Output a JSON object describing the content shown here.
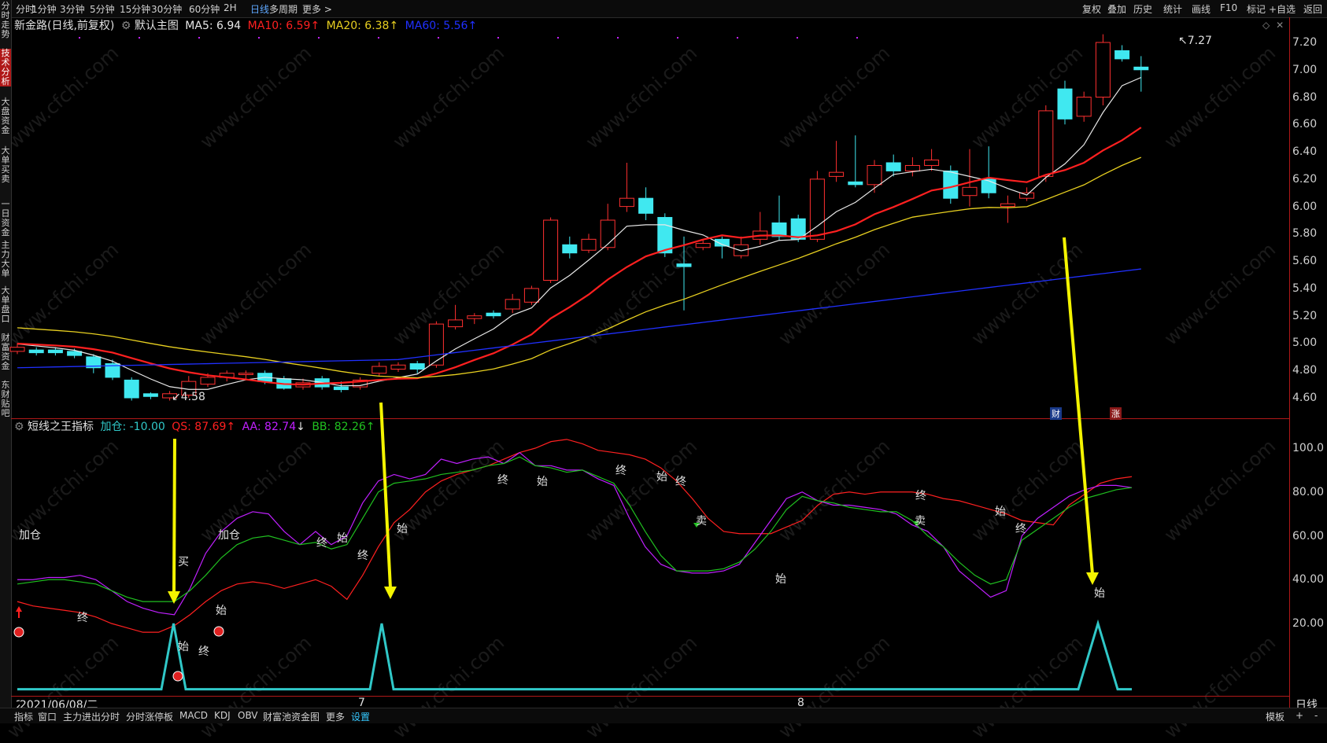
{
  "toolbar": {
    "left_items": [
      "分时",
      "1分钟",
      "3分钟",
      "5分钟",
      "15分钟",
      "30分钟",
      "60分钟",
      "2H",
      "日线",
      "多周期",
      "更多 >"
    ],
    "active_index": 8,
    "right_items": [
      "复权",
      "叠加",
      "历史",
      "统计",
      "画线",
      "F10",
      "标记",
      "+自选",
      "返回"
    ]
  },
  "sidebar": {
    "tabs": [
      "分时走势",
      "技术分析",
      "大盘资金",
      "大单买卖",
      "一日资金",
      "主力大单",
      "大单盘口",
      "财富资金",
      "东财贴吧"
    ],
    "active_index": 1
  },
  "main_chart": {
    "title": "新金路(日线,前复权)",
    "template_label": "默认主图",
    "ma5": "MA5: 6.94",
    "ma10": "MA10: 6.59",
    "ma20": "MA20: 6.38",
    "ma60": "MA60: 5.56",
    "colors": {
      "ma5": "#e8e8e8",
      "ma10": "#ff2020",
      "ma20": "#e8d020",
      "ma60": "#2030ff",
      "up": "#ff3030",
      "down": "#40e8f0"
    },
    "high_label": "7.27",
    "low_label": "4.58",
    "markers": [
      "财",
      "涨"
    ],
    "y_ticks": [
      "7.20",
      "7.00",
      "6.80",
      "6.60",
      "6.40",
      "6.20",
      "6.00",
      "5.80",
      "5.60",
      "5.40",
      "5.20",
      "5.00",
      "4.80",
      "4.60"
    ]
  },
  "indicator": {
    "name": "短线之王指标",
    "jiacang": "加仓: -10.00",
    "qs": "QS: 87.69",
    "aa": "AA: 82.74",
    "bb": "BB: 82.26",
    "colors": {
      "jiacang": "#30c8c8",
      "qs": "#ff2020",
      "aa": "#c020ff",
      "bb": "#20c020"
    },
    "y_ticks": [
      "100.0",
      "80.00",
      "60.00",
      "40.00",
      "20.00"
    ],
    "signals": {
      "add": "加仓",
      "buy": "买",
      "sell": "卖",
      "begin": "始",
      "end": "终"
    }
  },
  "x_axis": {
    "date": "2021/06/08/二",
    "m7": "7",
    "m8": "8",
    "period": "日线"
  },
  "bottom_tabs": [
    "指标",
    "窗口",
    "主力进出分时",
    "分时涨停板",
    "MACD",
    "KDJ",
    "OBV",
    "财富池资金图",
    "更多",
    "设置"
  ],
  "bottom_active_index": 9,
  "bottom_right": [
    "模板",
    "+",
    "-"
  ],
  "watermark": "www.cfchi.com"
}
